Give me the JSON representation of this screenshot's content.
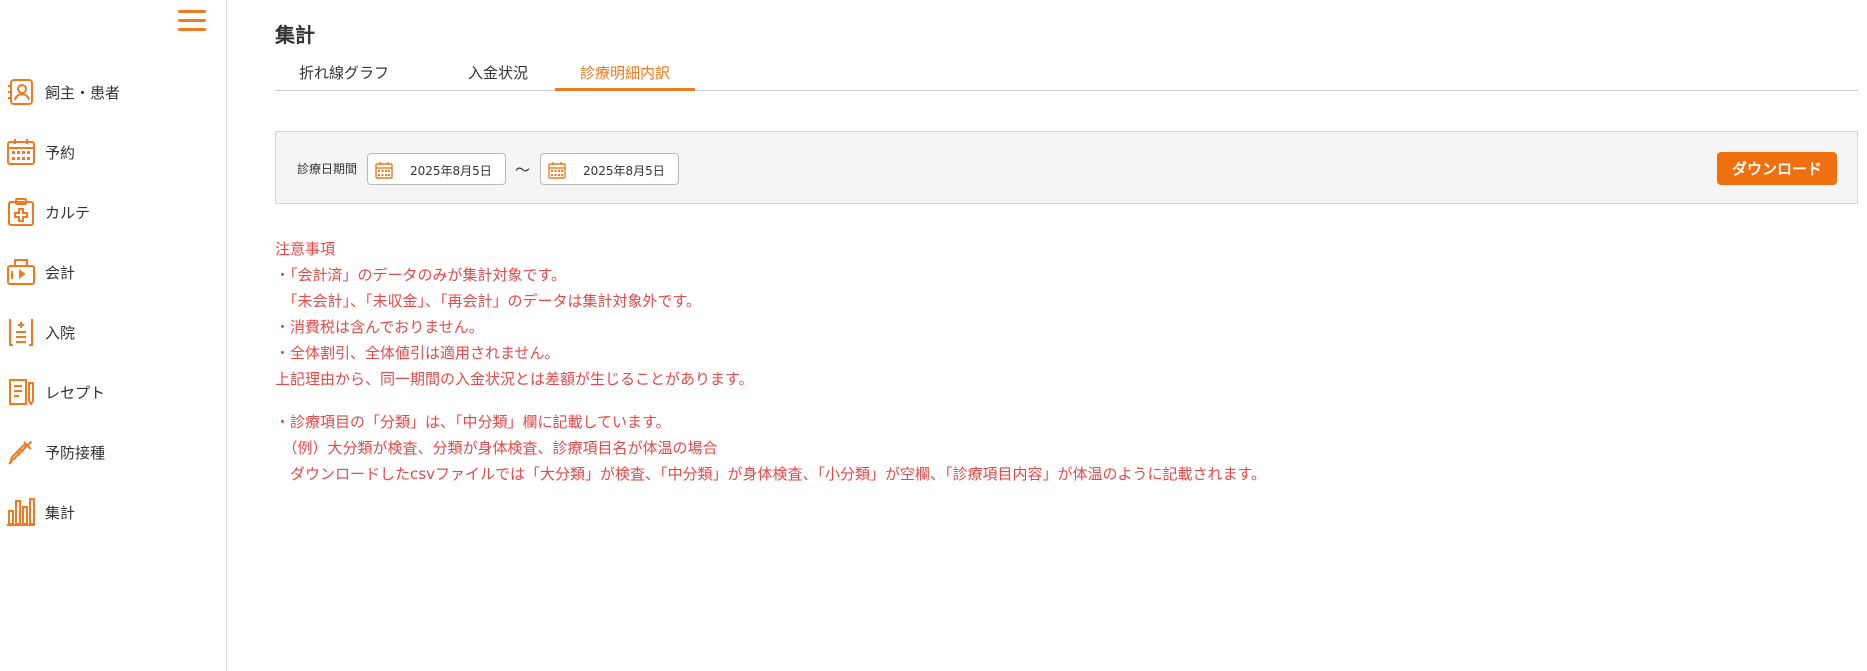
{
  "sidebar": {
    "items": [
      {
        "label": "飼主・患者",
        "icon": "owner-patient-icon"
      },
      {
        "label": "予約",
        "icon": "calendar-icon"
      },
      {
        "label": "カルテ",
        "icon": "medical-chart-icon"
      },
      {
        "label": "会計",
        "icon": "register-icon"
      },
      {
        "label": "入院",
        "icon": "hospitalization-icon"
      },
      {
        "label": "レセプト",
        "icon": "receipt-icon"
      },
      {
        "label": "予防接種",
        "icon": "syringe-icon"
      },
      {
        "label": "集計",
        "icon": "bar-chart-icon"
      }
    ]
  },
  "main": {
    "title": "集計",
    "tabs": [
      {
        "label": "折れ線グラフ"
      },
      {
        "label": "入金状況"
      },
      {
        "label": "診療明細内訳"
      }
    ],
    "active_tab": "診療明細内訳",
    "filter": {
      "label": "診療日期間",
      "start_date": "2025年8月5日",
      "end_date": "2025年8月5日",
      "separator": "〜",
      "download_label": "ダウンロード"
    },
    "notes": {
      "heading": "注意事項",
      "lines_block1": [
        "・「会計済」のデータのみが集計対象です。",
        "　「未会計」、「未収金」、「再会計」のデータは集計対象外です。",
        "・消費税は含んでおりません。",
        "・全体割引、全体値引は適用されません。",
        "上記理由から、同一期間の入金状況とは差額が生じることがあります。"
      ],
      "lines_block2": [
        "・診療項目の「分類」は、「中分類」欄に記載しています。",
        "　（例）大分類が検査、分類が身体検査、診療項目名が体温の場合",
        "　ダウンロードしたcsvファイルでは「大分類」が検査、「中分類」が身体検査、「小分類」が空欄、「診療項目内容」が体温のように記載されます。"
      ]
    }
  },
  "colors": {
    "accent": "#f07a1f",
    "note_text": "#e34a4a"
  }
}
